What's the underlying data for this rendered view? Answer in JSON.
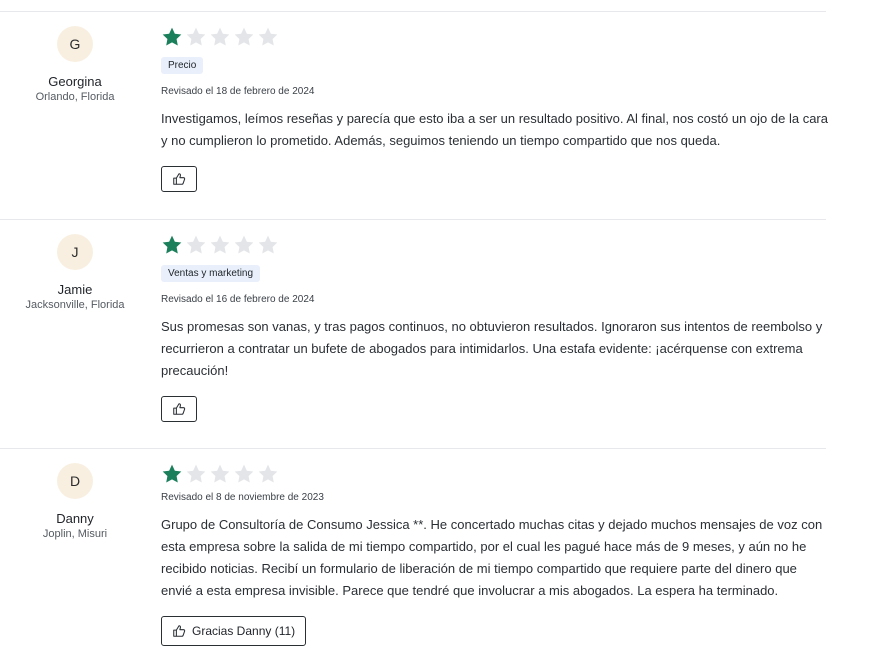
{
  "colors": {
    "star_filled": "#1a7f5a",
    "star_empty": "#e3e5e8",
    "tag_bg": "#e9f0fb",
    "avatar_bg": "#f8efe1"
  },
  "reviews": [
    {
      "initial": "G",
      "name": "Georgina",
      "location": "Orlando, Florida",
      "rating": 1,
      "max_rating": 5,
      "tag": "Precio",
      "date": "Revisado el 18 de febrero de 2024",
      "text": "Investigamos, leímos reseñas y parecía que esto iba a ser un resultado positivo. Al final, nos costó un ojo de la cara y no cumplieron lo prometido. Además, seguimos teniendo un tiempo compartido que nos queda.",
      "helpful_label": "",
      "helpful_icon": "thumbs-up-icon"
    },
    {
      "initial": "J",
      "name": "Jamie",
      "location": "Jacksonville, Florida",
      "rating": 1,
      "max_rating": 5,
      "tag": "Ventas y marketing",
      "date": "Revisado el 16 de febrero de 2024",
      "text": "Sus promesas son vanas, y tras pagos continuos, no obtuvieron resultados. Ignoraron sus intentos de reembolso y recurrieron a contratar un bufete de abogados para intimidarlos. Una estafa evidente: ¡acérquense con extrema precaución!",
      "helpful_label": "",
      "helpful_icon": "thumbs-up-icon"
    },
    {
      "initial": "D",
      "name": "Danny",
      "location": "Joplin, Misuri",
      "rating": 1,
      "max_rating": 5,
      "tag": "",
      "date": "Revisado el 8 de noviembre de 2023",
      "text": "Grupo de Consultoría de Consumo Jessica **. He concertado muchas citas y dejado muchos mensajes de voz con esta empresa sobre la salida de mi tiempo compartido, por el cual les pagué hace más de 9 meses, y aún no he recibido noticias. Recibí un formulario de liberación de mi tiempo compartido que requiere parte del dinero que envié a esta empresa invisible. Parece que tendré que involucrar a mis abogados. La espera ha terminado.",
      "helpful_label": "Gracias Danny (11)",
      "helpful_icon": "thumbs-up-icon"
    }
  ]
}
